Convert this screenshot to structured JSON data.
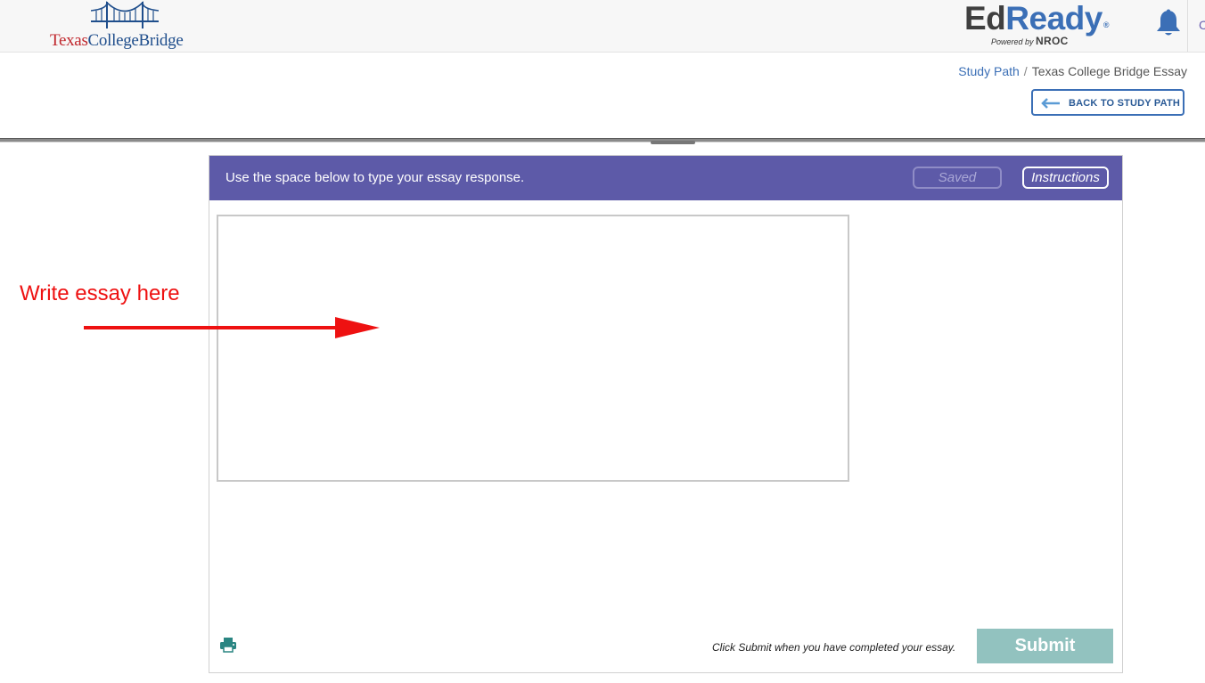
{
  "header": {
    "logo_left": {
      "part1": "Texas",
      "part2": "CollegeBridge"
    },
    "logo_right": {
      "part1": "Ed",
      "part2": "Ready",
      "reg_mark": "®",
      "powered_by": "Powered by",
      "nroc": "NROC"
    },
    "edge_glyph": "C"
  },
  "breadcrumb": {
    "link": "Study Path",
    "separator": "/",
    "current": "Texas College Bridge Essay"
  },
  "back_button": {
    "label": "BACK TO STUDY PATH"
  },
  "essay_panel": {
    "instruction": "Use the space below to type your essay response.",
    "saved_label": "Saved",
    "instructions_label": "Instructions",
    "essay_value": "",
    "submit_hint": "Click Submit when you have completed your essay.",
    "submit_label": "Submit"
  },
  "annotation": {
    "text": "Write essay here"
  },
  "colors": {
    "header_bar": "#5d5aa8",
    "brand_blue": "#3b6fb6",
    "brand_red": "#c0272d",
    "submit_disabled": "#92c2bf",
    "annotation_red": "#ee1111",
    "print_icon": "#2a8582"
  },
  "icons": {
    "logo": "bridge-icon",
    "notification": "bell-icon",
    "back": "arrow-left-icon",
    "print": "printer-icon",
    "annotation": "arrow-right-icon"
  }
}
